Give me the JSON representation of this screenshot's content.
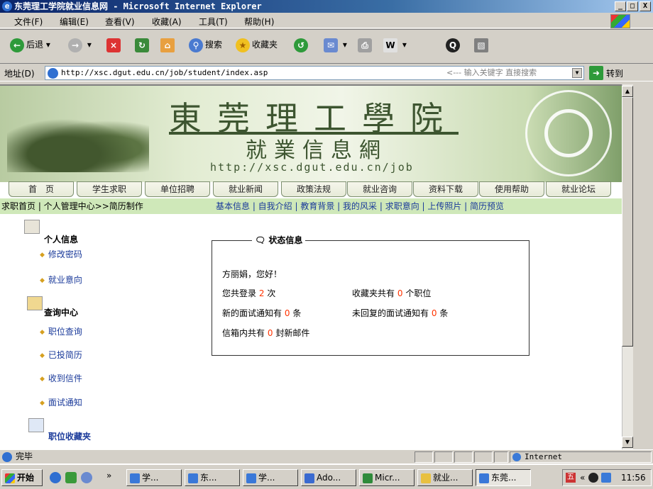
{
  "window": {
    "title": "东莞理工学院就业信息网 - Microsoft Internet Explorer",
    "controls": {
      "minimize": "_",
      "maximize": "□",
      "close": "X"
    }
  },
  "menu": [
    "文件(F)",
    "编辑(E)",
    "查看(V)",
    "收藏(A)",
    "工具(T)",
    "帮助(H)"
  ],
  "toolbar": {
    "back": "后退",
    "search": "搜索",
    "favorites": "收藏夹"
  },
  "address": {
    "label": "地址(D)",
    "url": "http://xsc.dgut.edu.cn/job/student/index.asp",
    "hint": "<--- 输入关键字 直接搜索",
    "go": "转到"
  },
  "banner": {
    "school": "東莞理工學院",
    "site": "就業信息網",
    "url": "http://xsc.dgut.edu.cn/job"
  },
  "nav": [
    "首　页",
    "学生求职",
    "单位招聘",
    "就业新闻",
    "政策法规",
    "就业咨询",
    "资料下载",
    "使用帮助",
    "就业论坛"
  ],
  "breadcrumb": "求职首页 | 个人管理中心>>简历制作",
  "sublinks": "基本信息 | 自我介绍 | 教育背景 | 我的风采 | 求职意向 | 上传照片 | 简历预览",
  "sidebar": {
    "personal": {
      "title": "个人信息",
      "items": [
        "修改密码",
        "就业意向"
      ]
    },
    "query": {
      "title": "查询中心",
      "items": [
        "职位查询",
        "已投简历",
        "收到信件",
        "面试通知"
      ]
    },
    "favorites": {
      "title": "职位收藏夹"
    }
  },
  "status": {
    "title": "状态信息",
    "greeting": "方丽娟，您好！",
    "login_pre": "您共登录",
    "login_count": "2",
    "login_post": "次",
    "fav_pre": "收藏夹共有",
    "fav_count": "0",
    "fav_post": "个职位",
    "new_pre": "新的面试通知有",
    "new_count": "0",
    "new_post": "条",
    "unrep_pre": "未回复的面试通知有",
    "unrep_count": "0",
    "unrep_post": "条",
    "mail_pre": "信箱内共有",
    "mail_count": "0",
    "mail_post": "封新邮件"
  },
  "statusbar": {
    "text": "完毕",
    "zone": "Internet"
  },
  "taskbar": {
    "start": "开始",
    "tasks": [
      "学...",
      "东...",
      "学...",
      "Ado...",
      "Micr...",
      "就业...",
      "东莞..."
    ],
    "time": "11:56"
  }
}
